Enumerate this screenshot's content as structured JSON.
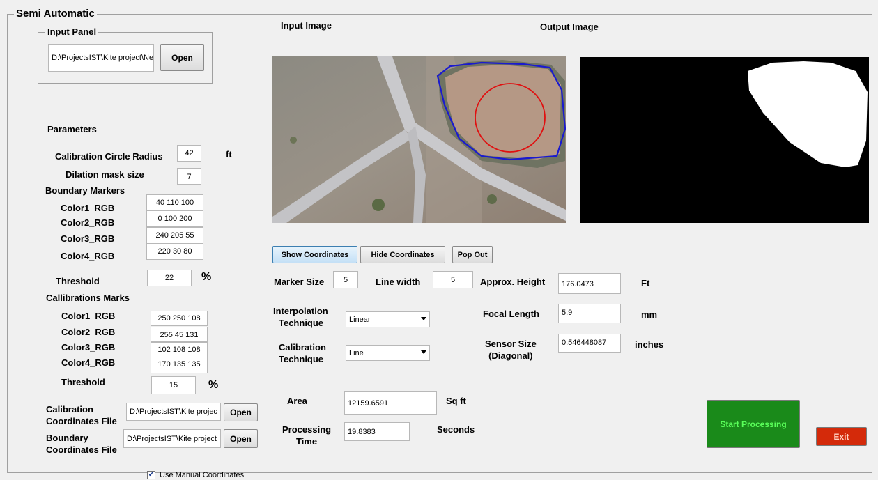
{
  "title": "Semi Automatic",
  "input_panel": {
    "title": "Input Panel",
    "path_value": "D:\\ProjectsIST\\Kite project\\Ne",
    "open_label": "Open"
  },
  "parameters": {
    "title": "Parameters",
    "cal_radius_label": "Calibration Circle Radius",
    "cal_radius_value": "42",
    "cal_radius_unit": "ft",
    "dilation_label": "Dilation mask size",
    "dilation_value": "7",
    "boundary_markers_label": "Boundary Markers",
    "boundary_colors": [
      {
        "label": "Color1_RGB",
        "value": "40 110 100"
      },
      {
        "label": "Color2_RGB",
        "value": "0 100 200"
      },
      {
        "label": "Color3_RGB",
        "value": "240 205 55"
      },
      {
        "label": "Color4_RGB",
        "value": "220 30 80"
      }
    ],
    "threshold_label": "Threshold",
    "threshold_value": "22",
    "threshold_unit": "%",
    "calib_marks_label": "Callibrations Marks",
    "calib_colors": [
      {
        "label": "Color1_RGB",
        "value": "250 250 108"
      },
      {
        "label": "Color2_RGB",
        "value": "255 45 131"
      },
      {
        "label": "Color3_RGB",
        "value": "102 108 108"
      },
      {
        "label": "Color4_RGB",
        "value": "170 135 135"
      }
    ],
    "calib_threshold_label": "Threshold",
    "calib_threshold_value": "15",
    "calib_threshold_unit": "%",
    "cal_file_label_1": "Calibration",
    "cal_file_label_2": "Coordinates File",
    "cal_file_value": "D:\\ProjectsIST\\Kite projec",
    "cal_file_open": "Open",
    "bnd_file_label_1": "Boundary",
    "bnd_file_label_2": "Coordinates File",
    "bnd_file_value": "D:\\ProjectsIST\\Kite project",
    "bnd_file_open": "Open",
    "manual_coords_label": "Use Manual Coordinates",
    "manual_coords_checked": true
  },
  "images": {
    "input_title": "Input Image",
    "output_title": "Output Image"
  },
  "toolbar": {
    "show_coords": "Show Coordinates",
    "hide_coords": "Hide Coordinates",
    "pop_out": "Pop Out"
  },
  "settings": {
    "marker_size_label": "Marker Size",
    "marker_size_value": "5",
    "line_width_label": "Line width",
    "line_width_value": "5",
    "interp_label_1": "Interpolation",
    "interp_label_2": "Technique",
    "interp_value": "Linear",
    "calib_tech_label_1": "Calibration",
    "calib_tech_label_2": "Technique",
    "calib_tech_value": "Line"
  },
  "camera": {
    "height_label": "Approx. Height",
    "height_value": "176.0473",
    "height_unit": "Ft",
    "focal_label": "Focal Length",
    "focal_value": "5.9",
    "focal_unit": "mm",
    "sensor_label_1": "Sensor Size",
    "sensor_label_2": "(Diagonal)",
    "sensor_value": "0.546448087",
    "sensor_unit": "inches"
  },
  "results": {
    "area_label": "Area",
    "area_value": "12159.6591",
    "area_unit": "Sq ft",
    "time_label_1": "Processing",
    "time_label_2": "Time",
    "time_value": "19.8383",
    "time_unit": "Seconds"
  },
  "actions": {
    "start_label": "Start Processing",
    "start_color": "#1a8a1a",
    "exit_label": "Exit",
    "exit_color": "#d42a0a"
  }
}
